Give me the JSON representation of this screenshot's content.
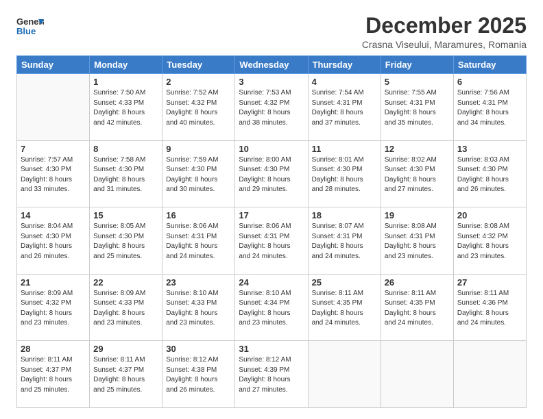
{
  "header": {
    "logo_line1": "General",
    "logo_line2": "Blue",
    "month_title": "December 2025",
    "location": "Crasna Viseului, Maramures, Romania"
  },
  "weekdays": [
    "Sunday",
    "Monday",
    "Tuesday",
    "Wednesday",
    "Thursday",
    "Friday",
    "Saturday"
  ],
  "weeks": [
    [
      {
        "day": "",
        "detail": ""
      },
      {
        "day": "1",
        "detail": "Sunrise: 7:50 AM\nSunset: 4:33 PM\nDaylight: 8 hours\nand 42 minutes."
      },
      {
        "day": "2",
        "detail": "Sunrise: 7:52 AM\nSunset: 4:32 PM\nDaylight: 8 hours\nand 40 minutes."
      },
      {
        "day": "3",
        "detail": "Sunrise: 7:53 AM\nSunset: 4:32 PM\nDaylight: 8 hours\nand 38 minutes."
      },
      {
        "day": "4",
        "detail": "Sunrise: 7:54 AM\nSunset: 4:31 PM\nDaylight: 8 hours\nand 37 minutes."
      },
      {
        "day": "5",
        "detail": "Sunrise: 7:55 AM\nSunset: 4:31 PM\nDaylight: 8 hours\nand 35 minutes."
      },
      {
        "day": "6",
        "detail": "Sunrise: 7:56 AM\nSunset: 4:31 PM\nDaylight: 8 hours\nand 34 minutes."
      }
    ],
    [
      {
        "day": "7",
        "detail": "Sunrise: 7:57 AM\nSunset: 4:30 PM\nDaylight: 8 hours\nand 33 minutes."
      },
      {
        "day": "8",
        "detail": "Sunrise: 7:58 AM\nSunset: 4:30 PM\nDaylight: 8 hours\nand 31 minutes."
      },
      {
        "day": "9",
        "detail": "Sunrise: 7:59 AM\nSunset: 4:30 PM\nDaylight: 8 hours\nand 30 minutes."
      },
      {
        "day": "10",
        "detail": "Sunrise: 8:00 AM\nSunset: 4:30 PM\nDaylight: 8 hours\nand 29 minutes."
      },
      {
        "day": "11",
        "detail": "Sunrise: 8:01 AM\nSunset: 4:30 PM\nDaylight: 8 hours\nand 28 minutes."
      },
      {
        "day": "12",
        "detail": "Sunrise: 8:02 AM\nSunset: 4:30 PM\nDaylight: 8 hours\nand 27 minutes."
      },
      {
        "day": "13",
        "detail": "Sunrise: 8:03 AM\nSunset: 4:30 PM\nDaylight: 8 hours\nand 26 minutes."
      }
    ],
    [
      {
        "day": "14",
        "detail": "Sunrise: 8:04 AM\nSunset: 4:30 PM\nDaylight: 8 hours\nand 26 minutes."
      },
      {
        "day": "15",
        "detail": "Sunrise: 8:05 AM\nSunset: 4:30 PM\nDaylight: 8 hours\nand 25 minutes."
      },
      {
        "day": "16",
        "detail": "Sunrise: 8:06 AM\nSunset: 4:31 PM\nDaylight: 8 hours\nand 24 minutes."
      },
      {
        "day": "17",
        "detail": "Sunrise: 8:06 AM\nSunset: 4:31 PM\nDaylight: 8 hours\nand 24 minutes."
      },
      {
        "day": "18",
        "detail": "Sunrise: 8:07 AM\nSunset: 4:31 PM\nDaylight: 8 hours\nand 24 minutes."
      },
      {
        "day": "19",
        "detail": "Sunrise: 8:08 AM\nSunset: 4:31 PM\nDaylight: 8 hours\nand 23 minutes."
      },
      {
        "day": "20",
        "detail": "Sunrise: 8:08 AM\nSunset: 4:32 PM\nDaylight: 8 hours\nand 23 minutes."
      }
    ],
    [
      {
        "day": "21",
        "detail": "Sunrise: 8:09 AM\nSunset: 4:32 PM\nDaylight: 8 hours\nand 23 minutes."
      },
      {
        "day": "22",
        "detail": "Sunrise: 8:09 AM\nSunset: 4:33 PM\nDaylight: 8 hours\nand 23 minutes."
      },
      {
        "day": "23",
        "detail": "Sunrise: 8:10 AM\nSunset: 4:33 PM\nDaylight: 8 hours\nand 23 minutes."
      },
      {
        "day": "24",
        "detail": "Sunrise: 8:10 AM\nSunset: 4:34 PM\nDaylight: 8 hours\nand 23 minutes."
      },
      {
        "day": "25",
        "detail": "Sunrise: 8:11 AM\nSunset: 4:35 PM\nDaylight: 8 hours\nand 24 minutes."
      },
      {
        "day": "26",
        "detail": "Sunrise: 8:11 AM\nSunset: 4:35 PM\nDaylight: 8 hours\nand 24 minutes."
      },
      {
        "day": "27",
        "detail": "Sunrise: 8:11 AM\nSunset: 4:36 PM\nDaylight: 8 hours\nand 24 minutes."
      }
    ],
    [
      {
        "day": "28",
        "detail": "Sunrise: 8:11 AM\nSunset: 4:37 PM\nDaylight: 8 hours\nand 25 minutes."
      },
      {
        "day": "29",
        "detail": "Sunrise: 8:11 AM\nSunset: 4:37 PM\nDaylight: 8 hours\nand 25 minutes."
      },
      {
        "day": "30",
        "detail": "Sunrise: 8:12 AM\nSunset: 4:38 PM\nDaylight: 8 hours\nand 26 minutes."
      },
      {
        "day": "31",
        "detail": "Sunrise: 8:12 AM\nSunset: 4:39 PM\nDaylight: 8 hours\nand 27 minutes."
      },
      {
        "day": "",
        "detail": ""
      },
      {
        "day": "",
        "detail": ""
      },
      {
        "day": "",
        "detail": ""
      }
    ]
  ]
}
